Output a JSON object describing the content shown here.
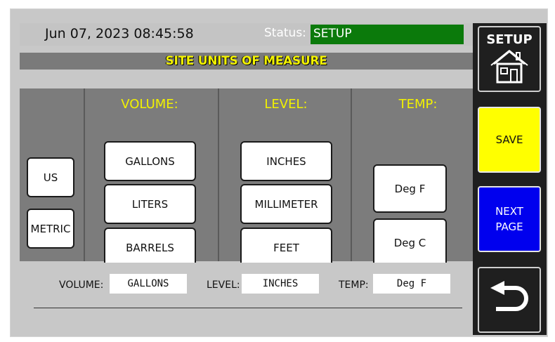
{
  "header": {
    "datetime": "Jun 07, 2023 08:45:58",
    "status_label": "Status:",
    "status_value": "SETUP"
  },
  "title": "SITE UNITS OF MEASURE",
  "system_buttons": {
    "us": "US",
    "metric": "METRIC"
  },
  "columns": {
    "volume": {
      "heading": "VOLUME:",
      "options": [
        "GALLONS",
        "LITERS",
        "BARRELS"
      ]
    },
    "level": {
      "heading": "LEVEL:",
      "options": [
        "INCHES",
        "MILLIMETER",
        "FEET"
      ]
    },
    "temp": {
      "heading": "TEMP:",
      "options": [
        "Deg F",
        "Deg C"
      ]
    }
  },
  "current": {
    "volume_label": "VOLUME:",
    "volume_value": "GALLONS",
    "level_label": "LEVEL:",
    "level_value": "INCHES",
    "temp_label": "TEMP:",
    "temp_value": "Deg F"
  },
  "sidebar": {
    "setup_label": "SETUP",
    "save_label": "SAVE",
    "next_page_label": "NEXT PAGE"
  },
  "colors": {
    "status_bg": "#0b7a0b",
    "title_text": "#f2f200",
    "save_bg": "#ffff00",
    "next_page_bg": "#0000ee",
    "sidebar_bg": "#1f1f1f"
  },
  "icons": {
    "home": "home-icon",
    "back": "back-arrow-icon"
  }
}
